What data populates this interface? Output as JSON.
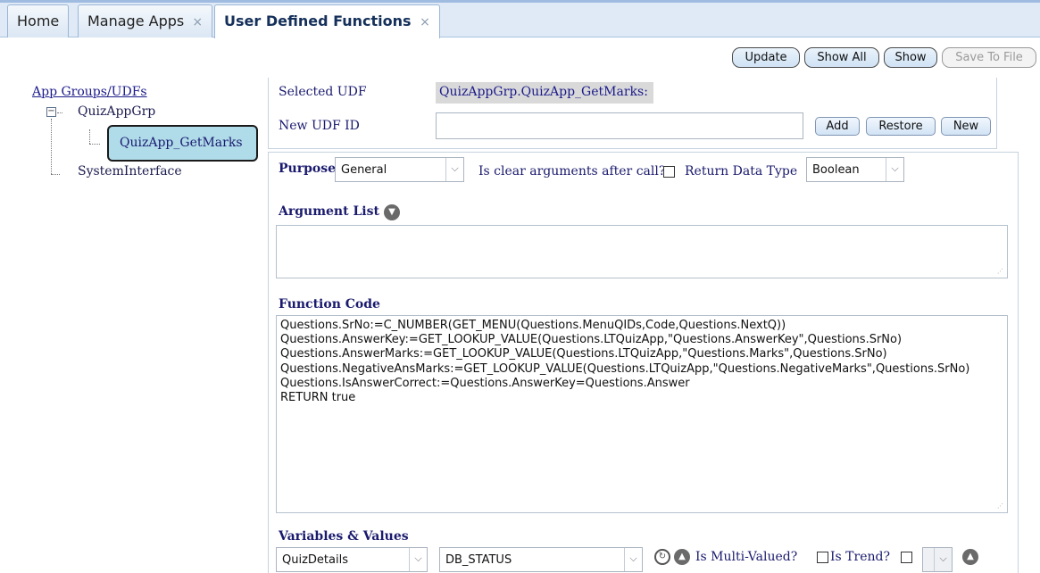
{
  "tabs": [
    {
      "label": "Home",
      "closable": false,
      "active": false
    },
    {
      "label": "Manage Apps",
      "closable": true,
      "active": false
    },
    {
      "label": "User Defined Functions",
      "closable": true,
      "active": true
    }
  ],
  "close_glyph": "×",
  "toolbar": {
    "update_label": "Update",
    "show_all_label": "Show All",
    "show_label": "Show",
    "save_to_file_label": "Save To File"
  },
  "tree": {
    "root_label": "App Groups/UDFs",
    "group_label": "QuizAppGrp",
    "selected_item_label": "QuizApp_GetMarks",
    "system_label": "SystemInterface",
    "collapse_glyph": "−"
  },
  "udf": {
    "selected_label": "Selected UDF",
    "selected_value": "QuizAppGrp.QuizApp_GetMarks:",
    "new_id_label": "New UDF ID",
    "new_id_value": "",
    "add_label": "Add",
    "restore_label": "Restore",
    "new_label": "New"
  },
  "form": {
    "purpose_label": "Purpose",
    "purpose_value": "General",
    "clear_args_label": "Is clear arguments after call?",
    "clear_args_checked": false,
    "return_type_label": "Return Data Type",
    "return_type_value": "Boolean",
    "argument_list_label": "Argument List",
    "argument_list_value": "",
    "function_code_label": "Function Code",
    "function_code": "Questions.SrNo:=C_NUMBER(GET_MENU(Questions.MenuQIDs,Code,Questions.NextQ))\nQuestions.AnswerKey:=GET_LOOKUP_VALUE(Questions.LTQuizApp,\"Questions.AnswerKey\",Questions.SrNo)\nQuestions.AnswerMarks:=GET_LOOKUP_VALUE(Questions.LTQuizApp,\"Questions.Marks\",Questions.SrNo)\nQuestions.NegativeAnsMarks:=GET_LOOKUP_VALUE(Questions.LTQuizApp,\"Questions.NegativeMarks\",Questions.SrNo)\nQuestions.IsAnswerCorrect:=Questions.AnswerKey=Questions.Answer\nRETURN true",
    "variables_label": "Variables & Values",
    "variable_group_value": "QuizDetails",
    "variable_value": "DB_STATUS",
    "multi_valued_label": "Is Multi-Valued?",
    "multi_valued_checked": false,
    "is_trend_label": "Is Trend?",
    "is_trend_checked": false
  },
  "icons": {
    "dropdown": "chevron-down-icon",
    "refresh": "refresh-icon",
    "collapse": "chevron-up-circle-icon",
    "expand": "chevron-down-circle-icon"
  },
  "colors": {
    "tab_bar": "#dfeaf6",
    "selected_node": "#b0dcea",
    "selected_udf_bg": "#d9d9d9",
    "label_text": "#1a1a6e"
  }
}
